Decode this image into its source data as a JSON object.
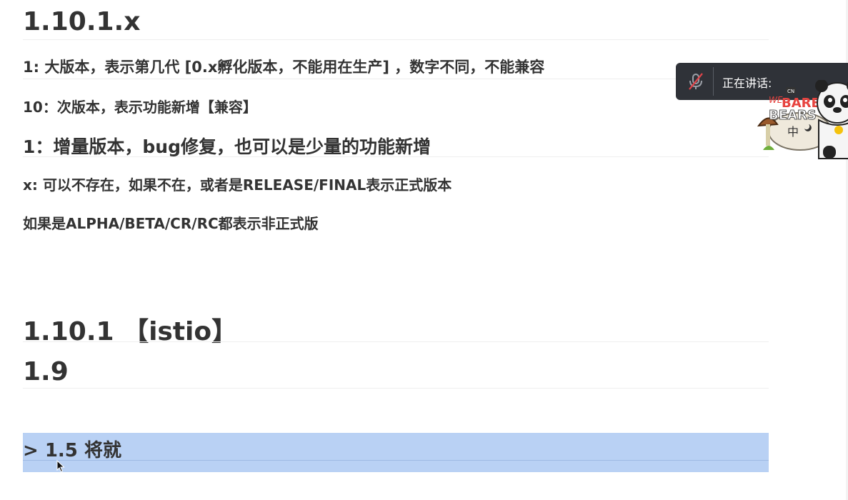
{
  "document": {
    "heading_1": "1.10.1.x",
    "line_major": "1: 大版本，表示第几代 [0.x孵化版本，不能用在生产] ，数字不同，不能兼容",
    "line_minor": "10：次版本，表示功能新增【兼容】",
    "line_patch": "1：增量版本，bug修复，也可以是少量的功能新增",
    "line_x": "x: 可以不存在，如果不在，或者是RELEASE/FINAL表示正式版本",
    "line_prerelease": "如果是ALPHA/BETA/CR/RC都表示非正式版",
    "heading_istio": "1.10.1 【istio】",
    "heading_19": "1.9",
    "selected_line": "> 1.5  将就"
  },
  "overlay": {
    "speaking_label": "正在讲话:",
    "sticker_brand": "CN",
    "sticker_title_1": "WE",
    "sticker_title_2": "BARE",
    "sticker_title_3": "BEARS",
    "sticker_tag": "中"
  },
  "colors": {
    "text": "#333333",
    "selection": "#b9d1f4",
    "panel": "#2f3238"
  }
}
